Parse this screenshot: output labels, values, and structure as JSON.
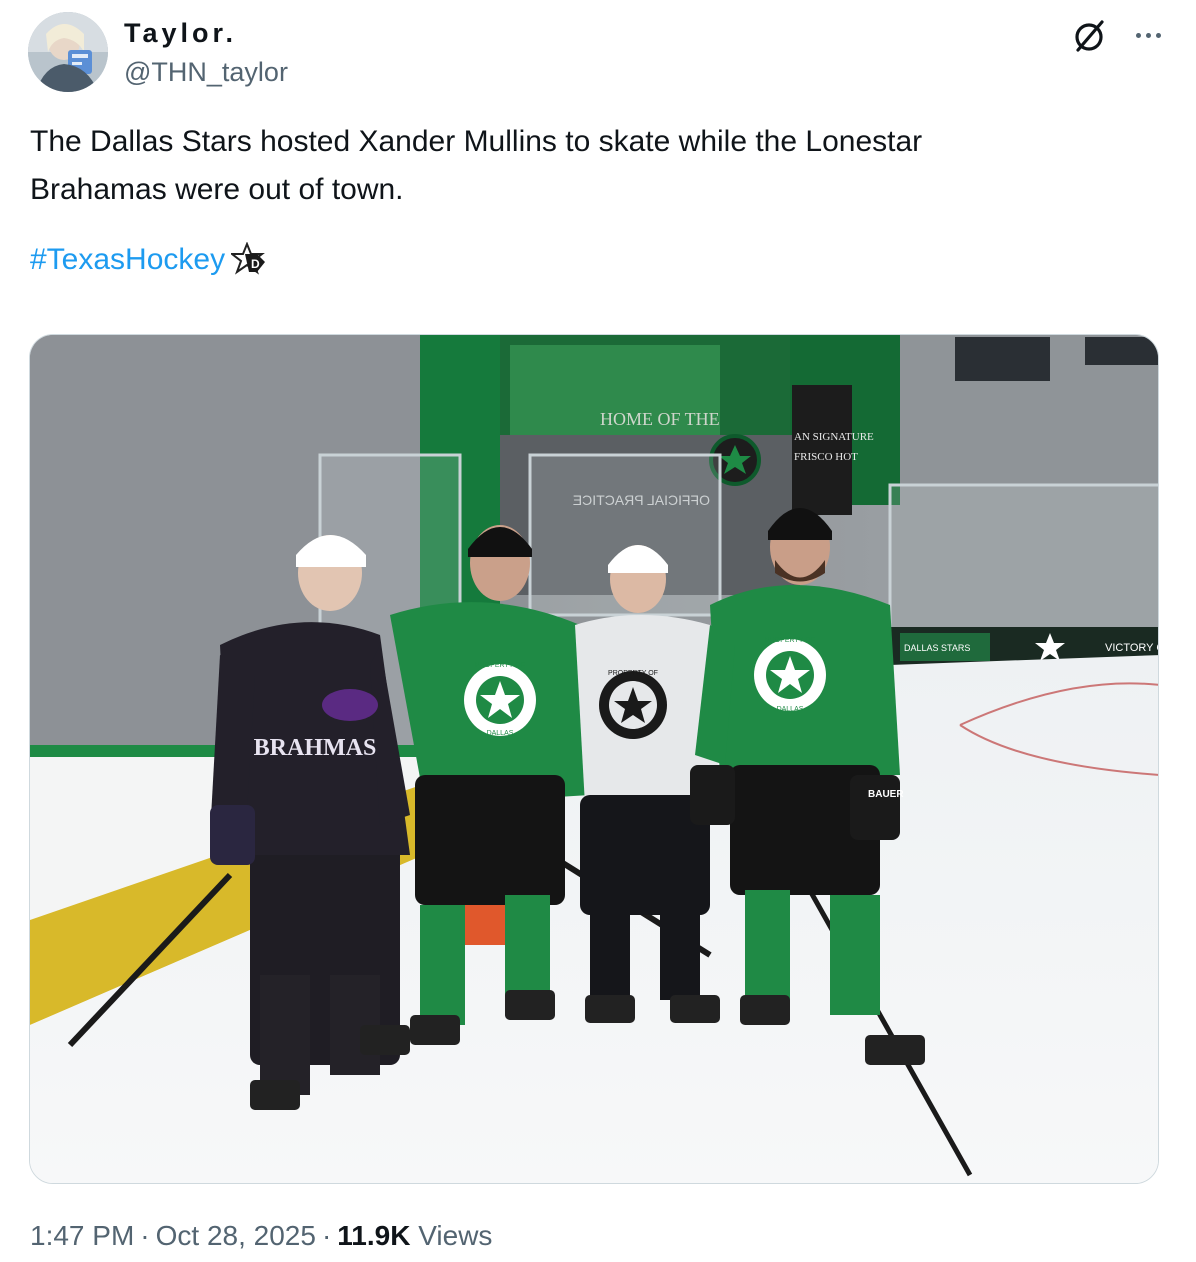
{
  "author": {
    "display_name": "Taylor.",
    "handle": "@THN_taylor"
  },
  "icons": {
    "grok": "grok-slash-circle-icon",
    "more": "more-dots-icon",
    "emoji": "dallas-stars-star-emoji"
  },
  "tweet": {
    "line1": "The Dallas Stars hosted Xander Mullins to skate while the Lonestar",
    "line2": "Brahamas were out of town.",
    "hashtag": "#TexasHockey"
  },
  "photo": {
    "alt": "Four hockey players standing on ice at a Dallas Stars practice rink",
    "signage": {
      "banner_home": "HOME OF THE",
      "official": "OFFICIAL PRACTICE",
      "hotel_line1": "AN SIGNATURE",
      "hotel_line2": "FRISCO HOT",
      "victory": "VICTORY C",
      "dallas_stars_board": "DALLAS STARS"
    },
    "jerseys": {
      "brahmas_text": "BRAHMAS",
      "property_of": "PROPERTY OF",
      "dallas": "DALLAS",
      "bauer": "BAUER"
    }
  },
  "meta": {
    "time": "1:47 PM",
    "date": "Oct 28, 2025",
    "views_count": "11.9K",
    "views_label": "Views",
    "separator": "·"
  },
  "colors": {
    "link": "#1d9bf0",
    "secondary_text": "#536471",
    "stars_green": "#1e8b45",
    "brahmas_purple": "#5a2a82"
  }
}
